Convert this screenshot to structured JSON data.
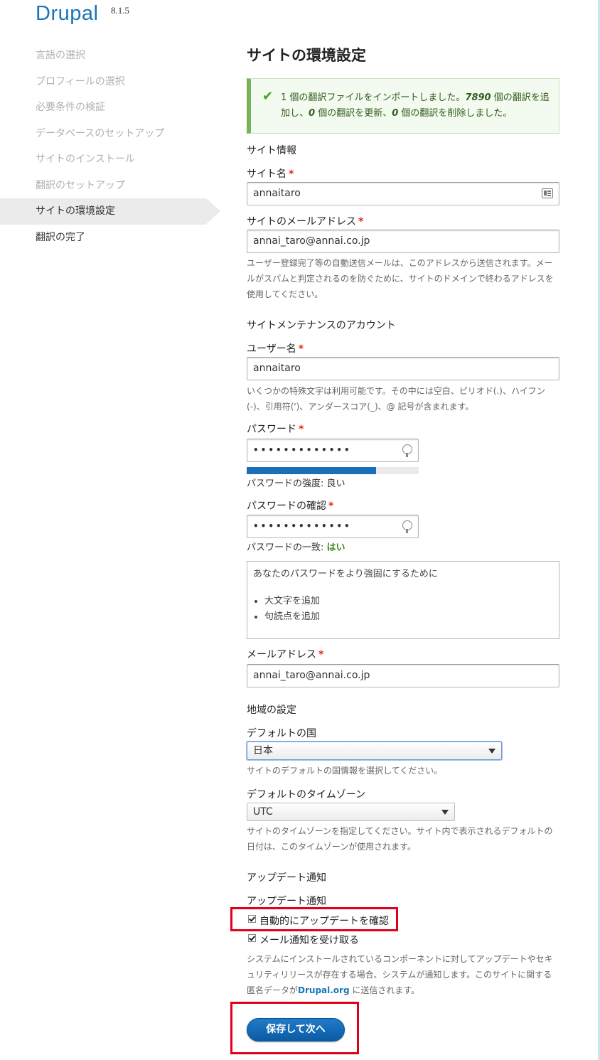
{
  "brand": {
    "name": "Drupal",
    "version": "8.1.5"
  },
  "sidebar": {
    "steps": [
      {
        "label": "言語の選択",
        "state": "done"
      },
      {
        "label": "プロフィールの選択",
        "state": "done"
      },
      {
        "label": "必要条件の検証",
        "state": "done"
      },
      {
        "label": "データベースのセットアップ",
        "state": "done"
      },
      {
        "label": "サイトのインストール",
        "state": "done"
      },
      {
        "label": "翻訳のセットアップ",
        "state": "done"
      },
      {
        "label": "サイトの環境設定",
        "state": "active"
      },
      {
        "label": "翻訳の完了",
        "state": "todo"
      }
    ]
  },
  "main": {
    "title": "サイトの環境設定",
    "message": {
      "part1": "1 個の翻訳ファイルをインポートしました。",
      "added": "7890",
      "part2": " 個の翻訳を追加し、",
      "updated": "0",
      "part3": " 個の翻訳を更新、",
      "deleted": "0",
      "part4": " 個の翻訳を削除しました。"
    },
    "site_info": {
      "heading": "サイト情報",
      "site_name_label": "サイト名",
      "site_name_value": "annaitaro",
      "site_mail_label": "サイトのメールアドレス",
      "site_mail_value": "annai_taro@annai.co.jp",
      "site_mail_desc": "ユーザー登録完了等の自動送信メールは、このアドレスから送信されます。メールがスパムと判定されるのを防ぐために、サイトのドメインで終わるアドレスを使用してください。"
    },
    "account": {
      "heading": "サイトメンテナンスのアカウント",
      "username_label": "ユーザー名",
      "username_value": "annaitaro",
      "username_desc": "いくつかの特殊文字は利用可能です。その中には空白、ピリオド(.)、ハイフン(-)、引用符(')、アンダースコア(_)、@ 記号が含まれます。",
      "password_label": "パスワード",
      "password_value": "•••••••••••••",
      "strength_label": "パスワードの強度: ",
      "strength_value": "良い",
      "strength_fraction": 0.75,
      "confirm_label": "パスワードの確認",
      "confirm_value": "•••••••••••••",
      "match_label": "パスワードの一致: ",
      "match_value": "はい",
      "suggest_title": "あなたのパスワードをより強固にするために",
      "suggestions": [
        "大文字を追加",
        "句読点を追加"
      ],
      "email_label": "メールアドレス",
      "email_value": "annai_taro@annai.co.jp"
    },
    "regional": {
      "heading": "地域の設定",
      "country_label": "デフォルトの国",
      "country_value": "日本",
      "country_desc": "サイトのデフォルトの国情報を選択してください。",
      "timezone_label": "デフォルトのタイムゾーン",
      "timezone_value": "UTC",
      "timezone_desc": "サイトのタイムゾーンを指定してください。サイト内で表示されるデフォルトの日付は、このタイムゾーンが使用されます。"
    },
    "updates": {
      "heading": "アップデート通知",
      "sub_heading": "アップデート通知",
      "check_auto_label": "自動的にアップデートを確認",
      "check_auto_checked": true,
      "check_mail_label": "メール通知を受け取る",
      "check_mail_checked": true,
      "desc_part1": "システムにインストールされているコンポーネントに対してアップデートやセキュリティリリースが存在する場合、システムが通知します。このサイトに関する匿名データが",
      "desc_link": "Drupal.org",
      "desc_part2": " に送信されます。"
    },
    "submit_label": "保存して次へ"
  },
  "colors": {
    "brand": "#1a74b8",
    "required": "#e32700",
    "message_border": "#77b259",
    "highlight": "#e0001a",
    "button": "#0c5aa3"
  }
}
